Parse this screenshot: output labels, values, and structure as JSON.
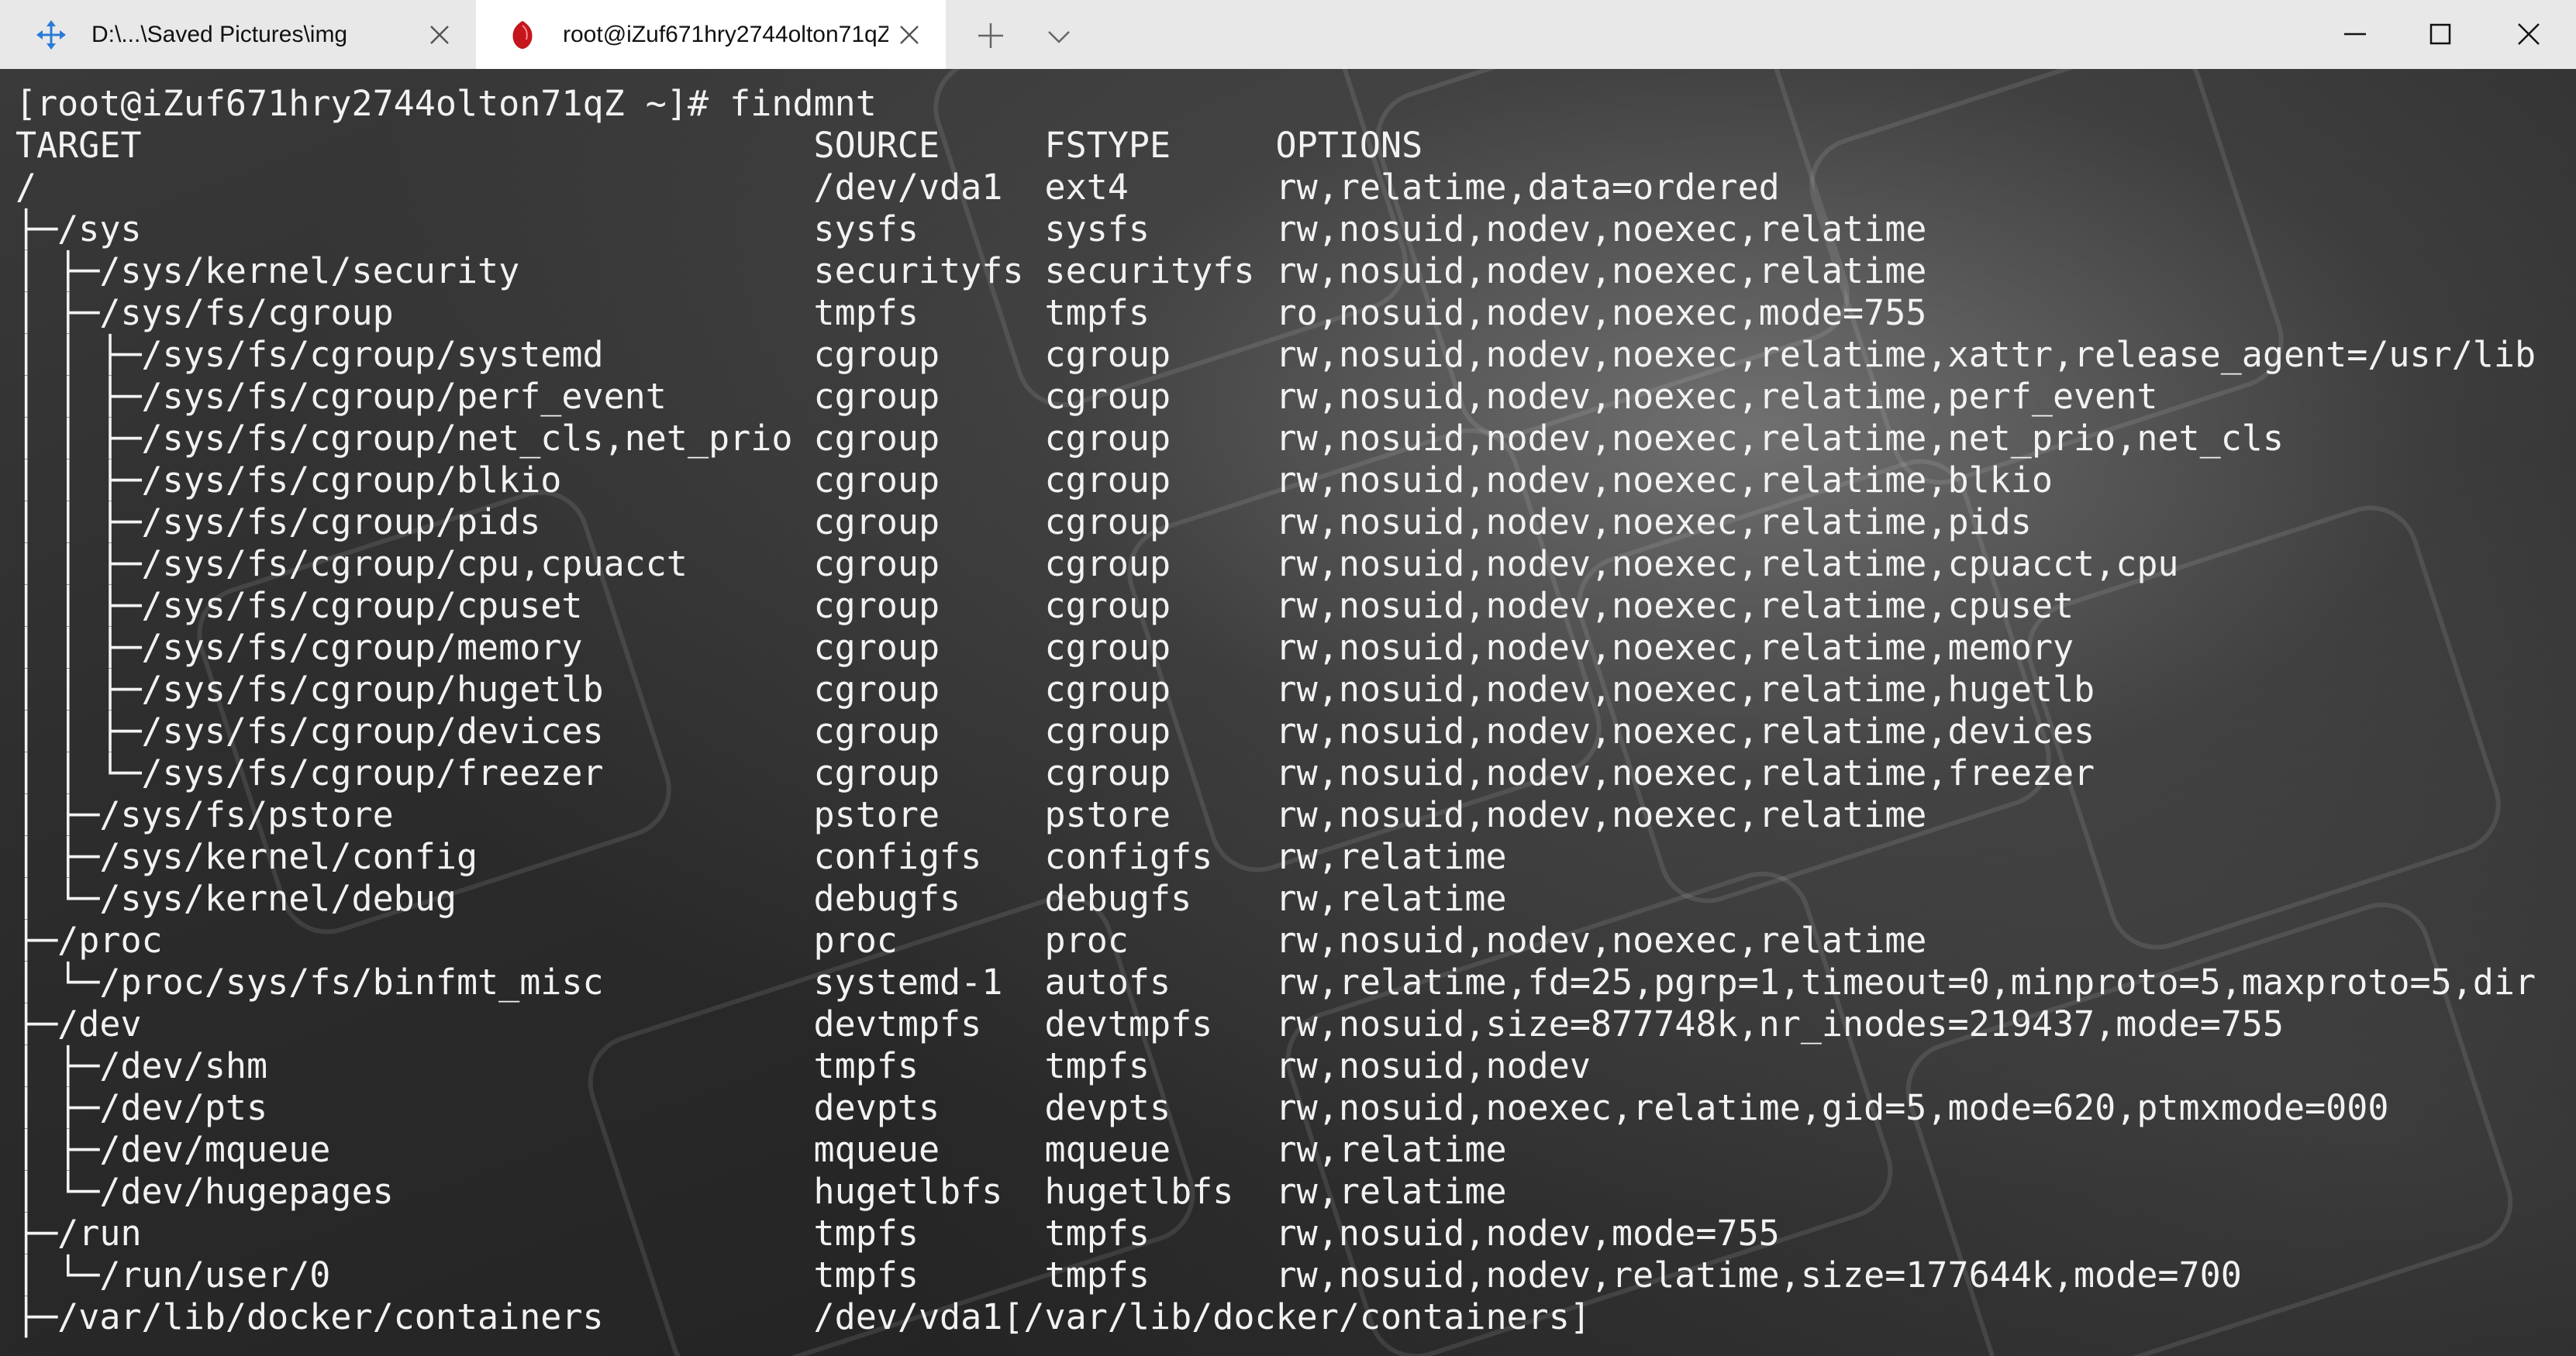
{
  "tabs": [
    {
      "title": "D:\\...\\Saved Pictures\\img",
      "icon": "move-arrows-icon",
      "active": false
    },
    {
      "title": "root@iZuf671hry2744olton71qZ",
      "icon": "ruby-icon",
      "active": true
    }
  ],
  "colors": {
    "titlebar": "#e8e8e8",
    "active_tab": "#ffffff",
    "terminal_text": "#f2f2f2",
    "tab1_icon": "#2b7bd8",
    "tab2_icon": "#c4161c"
  },
  "terminal": {
    "prompt": "[root@iZuf671hry2744olton71qZ ~]# findmnt",
    "lines": [
      "TARGET                                SOURCE     FSTYPE     OPTIONS",
      "/                                     /dev/vda1  ext4       rw,relatime,data=ordered",
      "├─/sys                                sysfs      sysfs      rw,nosuid,nodev,noexec,relatime",
      "│ ├─/sys/kernel/security              securityfs securityfs rw,nosuid,nodev,noexec,relatime",
      "│ ├─/sys/fs/cgroup                    tmpfs      tmpfs      ro,nosuid,nodev,noexec,mode=755",
      "│ │ ├─/sys/fs/cgroup/systemd          cgroup     cgroup     rw,nosuid,nodev,noexec,relatime,xattr,release_agent=/usr/lib",
      "│ │ ├─/sys/fs/cgroup/perf_event       cgroup     cgroup     rw,nosuid,nodev,noexec,relatime,perf_event",
      "│ │ ├─/sys/fs/cgroup/net_cls,net_prio cgroup     cgroup     rw,nosuid,nodev,noexec,relatime,net_prio,net_cls",
      "│ │ ├─/sys/fs/cgroup/blkio            cgroup     cgroup     rw,nosuid,nodev,noexec,relatime,blkio",
      "│ │ ├─/sys/fs/cgroup/pids             cgroup     cgroup     rw,nosuid,nodev,noexec,relatime,pids",
      "│ │ ├─/sys/fs/cgroup/cpu,cpuacct      cgroup     cgroup     rw,nosuid,nodev,noexec,relatime,cpuacct,cpu",
      "│ │ ├─/sys/fs/cgroup/cpuset           cgroup     cgroup     rw,nosuid,nodev,noexec,relatime,cpuset",
      "│ │ ├─/sys/fs/cgroup/memory           cgroup     cgroup     rw,nosuid,nodev,noexec,relatime,memory",
      "│ │ ├─/sys/fs/cgroup/hugetlb          cgroup     cgroup     rw,nosuid,nodev,noexec,relatime,hugetlb",
      "│ │ ├─/sys/fs/cgroup/devices          cgroup     cgroup     rw,nosuid,nodev,noexec,relatime,devices",
      "│ │ └─/sys/fs/cgroup/freezer          cgroup     cgroup     rw,nosuid,nodev,noexec,relatime,freezer",
      "│ ├─/sys/fs/pstore                    pstore     pstore     rw,nosuid,nodev,noexec,relatime",
      "│ ├─/sys/kernel/config                configfs   configfs   rw,relatime",
      "│ └─/sys/kernel/debug                 debugfs    debugfs    rw,relatime",
      "├─/proc                               proc       proc       rw,nosuid,nodev,noexec,relatime",
      "│ └─/proc/sys/fs/binfmt_misc          systemd-1  autofs     rw,relatime,fd=25,pgrp=1,timeout=0,minproto=5,maxproto=5,dir",
      "├─/dev                                devtmpfs   devtmpfs   rw,nosuid,size=877748k,nr_inodes=219437,mode=755",
      "│ ├─/dev/shm                          tmpfs      tmpfs      rw,nosuid,nodev",
      "│ ├─/dev/pts                          devpts     devpts     rw,nosuid,noexec,relatime,gid=5,mode=620,ptmxmode=000",
      "│ ├─/dev/mqueue                       mqueue     mqueue     rw,relatime",
      "│ └─/dev/hugepages                    hugetlbfs  hugetlbfs  rw,relatime",
      "├─/run                                tmpfs      tmpfs      rw,nosuid,nodev,mode=755",
      "│ └─/run/user/0                       tmpfs      tmpfs      rw,nosuid,nodev,relatime,size=177644k,mode=700",
      "├─/var/lib/docker/containers          /dev/vda1[/var/lib/docker/containers]"
    ]
  }
}
